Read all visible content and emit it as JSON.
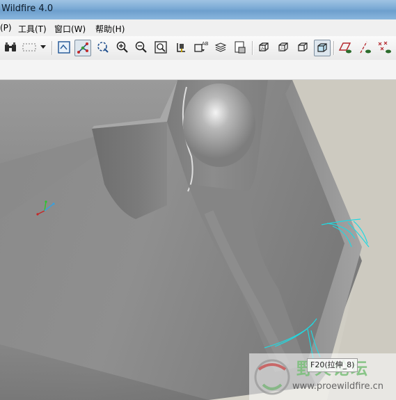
{
  "window": {
    "title": "Wildfire 4.0"
  },
  "menu": [
    "(P)",
    "工具(T)",
    "窗口(W)",
    "帮助(H)"
  ],
  "toolbar": {
    "buttons": [
      {
        "name": "find-icon"
      },
      {
        "name": "select-box-icon"
      },
      {
        "name": "dropdown-arrow-icon"
      },
      {
        "name": "repaint-icon"
      },
      {
        "name": "spin-center-icon",
        "active": true
      },
      {
        "name": "orient-mode-icon"
      },
      {
        "name": "zoom-in-icon"
      },
      {
        "name": "zoom-out-icon"
      },
      {
        "name": "refit-icon"
      },
      {
        "name": "reorient-icon"
      },
      {
        "name": "saved-views-icon"
      },
      {
        "name": "layers-icon"
      },
      {
        "name": "view-manager-icon"
      },
      {
        "name": "wireframe-icon"
      },
      {
        "name": "hidden-line-icon"
      },
      {
        "name": "no-hidden-icon"
      },
      {
        "name": "shading-icon",
        "active": true
      },
      {
        "name": "datum-planes-icon"
      },
      {
        "name": "datum-axes-icon"
      },
      {
        "name": "datum-points-icon"
      }
    ]
  },
  "viewport": {
    "highlight_color": "#22d8e0",
    "tooltip": "F20(拉伸_8)"
  },
  "watermark": {
    "title": "野火论坛",
    "url": "www.proewildfire.cn"
  }
}
